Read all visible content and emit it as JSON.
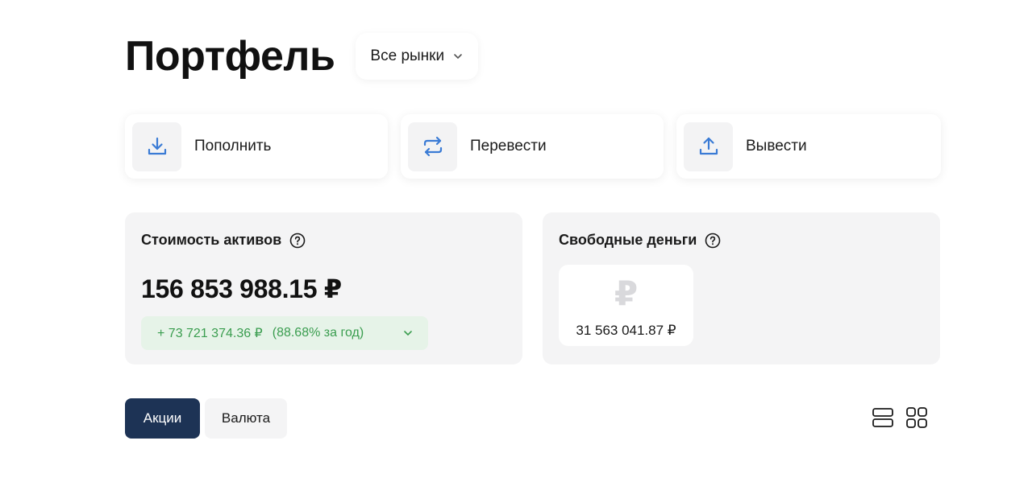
{
  "header": {
    "title": "Портфель",
    "market_select": "Все рынки"
  },
  "actions": [
    {
      "label": "Пополнить",
      "icon": "download-icon"
    },
    {
      "label": "Перевести",
      "icon": "transfer-icon"
    },
    {
      "label": "Вывести",
      "icon": "upload-icon"
    }
  ],
  "assets": {
    "title": "Стоимость активов",
    "value": "156 853 988.15 ₽",
    "change": "+ 73 721 374.36 ₽",
    "change_pct": "(88.68% за год)"
  },
  "cash": {
    "title": "Свободные деньги",
    "currency_symbol": "₽",
    "value": "31 563 041.87 ₽"
  },
  "tabs": [
    {
      "label": "Акции",
      "active": true
    },
    {
      "label": "Валюта",
      "active": false
    }
  ],
  "colors": {
    "accent_blue": "#3a7bd5",
    "active_tab": "#1d3355",
    "positive": "#3a9d4f",
    "panel_bg": "#f4f4f5"
  }
}
